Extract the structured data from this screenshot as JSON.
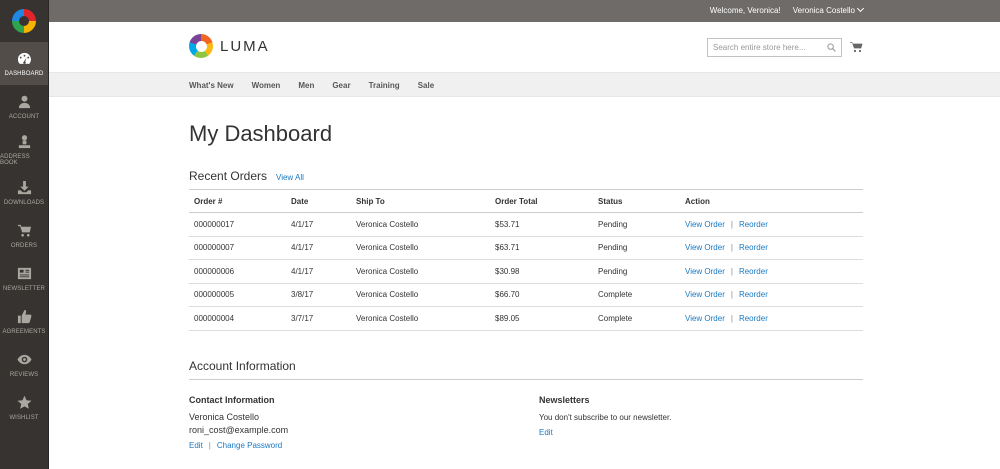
{
  "sidebar": {
    "items": [
      {
        "label": "DASHBOARD",
        "icon": "dashboard-icon"
      },
      {
        "label": "ACCOUNT",
        "icon": "user-icon"
      },
      {
        "label": "ADDRESS BOOK",
        "icon": "address-book-icon"
      },
      {
        "label": "DOWNLOADS",
        "icon": "download-icon"
      },
      {
        "label": "ORDERS",
        "icon": "orders-icon"
      },
      {
        "label": "NEWSLETTER",
        "icon": "newsletter-icon"
      },
      {
        "label": "AGREEMENTS",
        "icon": "thumbs-up-icon"
      },
      {
        "label": "REVIEWS",
        "icon": "eye-icon"
      },
      {
        "label": "WISHLIST",
        "icon": "star-icon"
      }
    ]
  },
  "topbar": {
    "welcome": "Welcome, Veronica!",
    "user_name": "Veronica Costello"
  },
  "header": {
    "logo_text": "LUMA",
    "search_placeholder": "Search entire store here..."
  },
  "nav": {
    "items": [
      "What's New",
      "Women",
      "Men",
      "Gear",
      "Training",
      "Sale"
    ]
  },
  "main": {
    "title": "My Dashboard",
    "recent_orders": {
      "title": "Recent Orders",
      "view_all": "View All",
      "columns": [
        "Order #",
        "Date",
        "Ship To",
        "Order Total",
        "Status",
        "Action"
      ],
      "rows": [
        {
          "order": "000000017",
          "date": "4/1/17",
          "ship_to": "Veronica Costello",
          "total": "$53.71",
          "status": "Pending",
          "view": "View Order",
          "reorder": "Reorder"
        },
        {
          "order": "000000007",
          "date": "4/1/17",
          "ship_to": "Veronica Costello",
          "total": "$63.71",
          "status": "Pending",
          "view": "View Order",
          "reorder": "Reorder"
        },
        {
          "order": "000000006",
          "date": "4/1/17",
          "ship_to": "Veronica Costello",
          "total": "$30.98",
          "status": "Pending",
          "view": "View Order",
          "reorder": "Reorder"
        },
        {
          "order": "000000005",
          "date": "3/8/17",
          "ship_to": "Veronica Costello",
          "total": "$66.70",
          "status": "Complete",
          "view": "View Order",
          "reorder": "Reorder"
        },
        {
          "order": "000000004",
          "date": "3/7/17",
          "ship_to": "Veronica Costello",
          "total": "$89.05",
          "status": "Complete",
          "view": "View Order",
          "reorder": "Reorder"
        }
      ]
    },
    "account_info": {
      "title": "Account Information",
      "contact": {
        "title": "Contact Information",
        "name": "Veronica Costello",
        "email": "roni_cost@example.com",
        "edit": "Edit",
        "change_password": "Change Password"
      },
      "newsletters": {
        "title": "Newsletters",
        "text": "You don't subscribe to our newsletter.",
        "edit": "Edit"
      }
    }
  },
  "colors": {
    "sidebar_bg": "#373330",
    "topbar_bg": "#6e6b69",
    "link": "#1979c3",
    "nav_bg": "#f0f0f0"
  }
}
